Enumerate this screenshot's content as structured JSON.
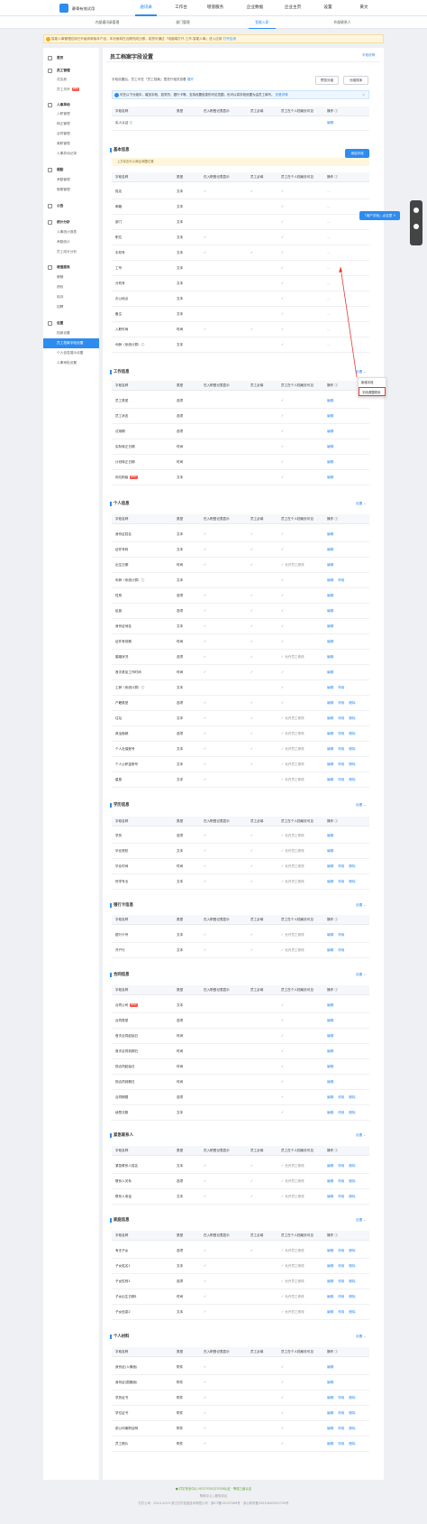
{
  "app_name": "静哥有效试用",
  "nav": [
    "通讯录",
    "工作台",
    "增值服务",
    "企业数据",
    "企业主页",
    "设置"
  ],
  "nav_user": "黄文",
  "subnav": [
    "内部通讯录管理",
    "部门管理",
    "智能入职",
    "外部联系人"
  ],
  "notice": {
    "text": "智能人事管理应用已升级到新版本产品，本页面将在近期完成迁移。若您可通过「电脑端打开-工作-智能人事」进入应用",
    "link": "打开应用"
  },
  "sidebar": {
    "items": [
      {
        "label": "首页",
        "type": "head"
      },
      {
        "label": "员工管理",
        "type": "head"
      },
      {
        "label": "花名册",
        "type": "sub"
      },
      {
        "label": "员工关怀",
        "type": "sub",
        "tag": "NEW"
      },
      {
        "label": "人事异动",
        "type": "head"
      },
      {
        "label": "入职管理",
        "type": "sub"
      },
      {
        "label": "转正管理",
        "type": "sub"
      },
      {
        "label": "合同管理",
        "type": "sub"
      },
      {
        "label": "离职管理",
        "type": "sub"
      },
      {
        "label": "人事异动记录",
        "type": "sub"
      },
      {
        "label": "假勤",
        "type": "head"
      },
      {
        "label": "考勤管理",
        "type": "sub"
      },
      {
        "label": "假期管理",
        "type": "sub"
      },
      {
        "label": "公告",
        "type": "head"
      },
      {
        "label": "统计分析",
        "type": "head"
      },
      {
        "label": "人事统计报表",
        "type": "sub"
      },
      {
        "label": "考勤统计",
        "type": "sub"
      },
      {
        "label": "员工成长分析",
        "type": "sub"
      },
      {
        "label": "增值服务",
        "type": "head"
      },
      {
        "label": "薪酬",
        "type": "sub"
      },
      {
        "label": "绩效",
        "type": "sub"
      },
      {
        "label": "培训",
        "type": "sub"
      },
      {
        "label": "招聘",
        "type": "sub"
      },
      {
        "label": "设置",
        "type": "head"
      },
      {
        "label": "档案设置",
        "type": "sub"
      },
      {
        "label": "员工档案字段设置",
        "type": "sub",
        "active": true
      },
      {
        "label": "个人信息展示设置",
        "type": "sub"
      },
      {
        "label": "人事审批设置",
        "type": "sub"
      }
    ]
  },
  "page": {
    "title": "员工档案字段设置",
    "help": "字段说明",
    "desc": "字段设置后，员工可在「员工档案」里进行相关查看",
    "desc_link": "展开",
    "btn_preview": "预览分组",
    "btn_sort": "分组排序",
    "info": "可在以下分组中，增加字段，如学历、银行卡等。支持设置信息的可见范围，也可以将字段设置为由员工填写。",
    "info_link": "查看详情",
    "add_field": "添加字段",
    "hint": "上方标志可以添加/调整位置",
    "setting": "设置 ⌄"
  },
  "headers": [
    "字段名称",
    "类型",
    "在入职登记表显示",
    "员工必填",
    "员工在个人档案页可见",
    "操作 ⓘ"
  ],
  "tip": "「用户字段」点这里 ✎",
  "dropdown": [
    "新增字段",
    "字段调整顺序"
  ],
  "sections": [
    {
      "id": "top",
      "title": "",
      "rows": [
        {
          "name": "实人认证 ⓘ",
          "type": "",
          "c1": "",
          "c2": "",
          "c3": "",
          "ops": [
            "编辑"
          ]
        }
      ]
    },
    {
      "id": "basic",
      "title": "基本信息",
      "rows": [
        {
          "name": "姓名",
          "type": "文本",
          "c1": "✓",
          "c2": "✓",
          "c3": "✓",
          "ops": [
            "—"
          ]
        },
        {
          "name": "邮箱",
          "type": "文本",
          "c1": "",
          "c2": "",
          "c3": "✓",
          "ops": [
            "—"
          ]
        },
        {
          "name": "部门",
          "type": "文本",
          "c1": "",
          "c2": "",
          "c3": "✓",
          "ops": [
            "—"
          ]
        },
        {
          "name": "职位",
          "type": "文本",
          "c1": "✓",
          "c2": "",
          "c3": "✓",
          "ops": [
            "—"
          ]
        },
        {
          "name": "手机号",
          "type": "文本",
          "c1": "✓",
          "c2": "✓",
          "c3": "✓",
          "ops": [
            "—"
          ]
        },
        {
          "name": "工号",
          "type": "文本",
          "c1": "",
          "c2": "",
          "c3": "✓",
          "ops": [
            "—"
          ]
        },
        {
          "name": "分机号",
          "type": "文本",
          "c1": "",
          "c2": "",
          "c3": "✓",
          "ops": [
            "—"
          ]
        },
        {
          "name": "办公地点",
          "type": "文本",
          "c1": "",
          "c2": "",
          "c3": "✓",
          "ops": [
            "—"
          ]
        },
        {
          "name": "备注",
          "type": "文本",
          "c1": "",
          "c2": "",
          "c3": "✓",
          "ops": [
            "—"
          ]
        },
        {
          "name": "入职时间",
          "type": "时间",
          "c1": "✓",
          "c2": "✓",
          "c3": "✓",
          "ops": [
            "—"
          ]
        },
        {
          "name": "司龄（系统计算）ⓘ",
          "type": "文本",
          "c1": "",
          "c2": "",
          "c3": "✓",
          "ops": [
            "—"
          ]
        }
      ]
    },
    {
      "id": "work",
      "title": "工作信息",
      "rows": [
        {
          "name": "员工类型",
          "type": "选项",
          "c1": "",
          "c2": "",
          "c3": "✓",
          "ops": [
            "编辑"
          ]
        },
        {
          "name": "员工状态",
          "type": "选项",
          "c1": "",
          "c2": "",
          "c3": "✓",
          "ops": [
            "编辑"
          ]
        },
        {
          "name": "试用期",
          "type": "选项",
          "c1": "",
          "c2": "",
          "c3": "✓",
          "ops": [
            "编辑"
          ]
        },
        {
          "name": "实际转正日期",
          "type": "时间",
          "c1": "",
          "c2": "",
          "c3": "✓",
          "ops": [
            "编辑"
          ]
        },
        {
          "name": "计划转正日期",
          "type": "时间",
          "c1": "",
          "c2": "",
          "c3": "✓",
          "ops": [
            "编辑"
          ]
        },
        {
          "name": "岗位职级",
          "tag": "NEW",
          "type": "文本",
          "c1": "",
          "c2": "",
          "c3": "✓",
          "ops": [
            "编辑"
          ]
        }
      ]
    },
    {
      "id": "personal",
      "title": "个人信息",
      "rows": [
        {
          "name": "身份证姓名",
          "type": "文本",
          "c1": "✓",
          "c2": "✓",
          "c3": "✓",
          "ops": [
            "编辑"
          ]
        },
        {
          "name": "证件号码",
          "type": "文本",
          "c1": "✓",
          "c2": "✓",
          "c3": "✓",
          "ops": [
            "编辑"
          ]
        },
        {
          "name": "出生日期",
          "type": "时间",
          "c1": "✓",
          "c2": "✓",
          "c3": "✓ 允许员工修改",
          "ops": [
            "编辑"
          ]
        },
        {
          "name": "年龄（系统计算）ⓘ",
          "type": "文本",
          "c1": "",
          "c2": "",
          "c3": "✓",
          "ops": [
            "编辑",
            "停用"
          ]
        },
        {
          "name": "性别",
          "type": "选项",
          "c1": "✓",
          "c2": "✓",
          "c3": "✓",
          "ops": [
            "编辑"
          ]
        },
        {
          "name": "民族",
          "type": "选项",
          "c1": "✓",
          "c2": "✓",
          "c3": "✓",
          "ops": [
            "编辑"
          ]
        },
        {
          "name": "身份证地址",
          "type": "文本",
          "c1": "✓",
          "c2": "✓",
          "c3": "✓",
          "ops": [
            "编辑"
          ]
        },
        {
          "name": "证件有效期",
          "type": "时间",
          "c1": "✓",
          "c2": "✓",
          "c3": "✓",
          "ops": [
            "编辑"
          ]
        },
        {
          "name": "婚姻状况",
          "type": "选项",
          "c1": "✓",
          "c2": "✓",
          "c3": "✓ 允许员工修改",
          "ops": [
            "编辑"
          ]
        },
        {
          "name": "首次参加工作时间",
          "type": "时间",
          "c1": "✓",
          "c2": "✓",
          "c3": "✓",
          "ops": [
            "编辑"
          ]
        },
        {
          "name": "工龄（系统计算）ⓘ",
          "type": "文本",
          "c1": "",
          "c2": "",
          "c3": "✓",
          "ops": [
            "编辑",
            "停用"
          ]
        },
        {
          "name": "户籍类型",
          "type": "选项",
          "c1": "✓",
          "c2": "✓",
          "c3": "✓",
          "ops": [
            "编辑",
            "停用",
            "删除"
          ]
        },
        {
          "name": "住址",
          "type": "文本",
          "c1": "✓",
          "c2": "✓",
          "c3": "✓ 允许员工修改",
          "ops": [
            "编辑",
            "停用",
            "删除"
          ]
        },
        {
          "name": "政治面貌",
          "type": "选项",
          "c1": "✓",
          "c2": "✓",
          "c3": "✓ 允许员工修改",
          "ops": [
            "编辑",
            "停用",
            "删除"
          ]
        },
        {
          "name": "个人社保账号",
          "type": "文本",
          "c1": "✓",
          "c2": "✓",
          "c3": "✓ 允许员工修改",
          "ops": [
            "编辑",
            "停用",
            "删除"
          ]
        },
        {
          "name": "个人公积金账号",
          "type": "文本",
          "c1": "✓",
          "c2": "✓",
          "c3": "✓ 允许员工修改",
          "ops": [
            "编辑",
            "停用",
            "删除"
          ]
        },
        {
          "name": "星座",
          "type": "文本",
          "c1": "✓",
          "c2": "",
          "c3": "✓ 允许员工修改",
          "ops": [
            "编辑",
            "停用",
            "删除"
          ]
        }
      ]
    },
    {
      "id": "edu",
      "title": "学历信息",
      "rows": [
        {
          "name": "学历",
          "type": "选项",
          "c1": "✓",
          "c2": "✓",
          "c3": "✓ 允许员工修改",
          "ops": [
            "编辑"
          ]
        },
        {
          "name": "毕业院校",
          "type": "文本",
          "c1": "✓",
          "c2": "✓",
          "c3": "✓ 允许员工修改",
          "ops": [
            "编辑"
          ]
        },
        {
          "name": "毕业时间",
          "type": "时间",
          "c1": "✓",
          "c2": "✓",
          "c3": "✓ 允许员工修改",
          "ops": [
            "编辑",
            "停用",
            "删除"
          ]
        },
        {
          "name": "所学专业",
          "type": "文本",
          "c1": "✓",
          "c2": "✓",
          "c3": "✓ 允许员工修改",
          "ops": [
            "编辑",
            "停用",
            "删除"
          ]
        }
      ]
    },
    {
      "id": "bank",
      "title": "银行卡信息",
      "rows": [
        {
          "name": "银行卡号",
          "type": "文本",
          "c1": "✓",
          "c2": "✓",
          "c3": "✓ 允许员工修改",
          "ops": [
            "编辑",
            "停用"
          ]
        },
        {
          "name": "开户行",
          "type": "文本",
          "c1": "✓",
          "c2": "✓",
          "c3": "✓ 允许员工修改",
          "ops": [
            "编辑",
            "停用"
          ]
        }
      ]
    },
    {
      "id": "contract",
      "title": "合同信息",
      "rows": [
        {
          "name": "合同公司",
          "tag": "NEW",
          "type": "文本",
          "c1": "",
          "c2": "",
          "c3": "✓",
          "ops": [
            "编辑"
          ]
        },
        {
          "name": "合同类型",
          "type": "选项",
          "c1": "",
          "c2": "",
          "c3": "✓",
          "ops": [
            "编辑"
          ]
        },
        {
          "name": "首次合同起始日",
          "type": "时间",
          "c1": "",
          "c2": "",
          "c3": "✓",
          "ops": [
            "编辑"
          ]
        },
        {
          "name": "首次合同到期日",
          "type": "时间",
          "c1": "",
          "c2": "",
          "c3": "✓",
          "ops": [
            "编辑"
          ]
        },
        {
          "name": "现合同起始日",
          "type": "时间",
          "c1": "",
          "c2": "",
          "c3": "✓",
          "ops": [
            "编辑"
          ]
        },
        {
          "name": "现合同到期日",
          "type": "时间",
          "c1": "",
          "c2": "",
          "c3": "✓",
          "ops": [
            "编辑"
          ]
        },
        {
          "name": "合同期限",
          "type": "选项",
          "c1": "",
          "c2": "",
          "c3": "✓",
          "ops": [
            "编辑",
            "停用",
            "删除"
          ]
        },
        {
          "name": "续签次数",
          "type": "文本",
          "c1": "",
          "c2": "",
          "c3": "✓",
          "ops": [
            "编辑",
            "停用",
            "删除"
          ]
        }
      ]
    },
    {
      "id": "emergency",
      "title": "紧急联系人",
      "rows": [
        {
          "name": "紧急联系人姓名",
          "type": "文本",
          "c1": "✓",
          "c2": "✓",
          "c3": "✓ 允许员工修改",
          "ops": [
            "编辑",
            "停用",
            "删除"
          ]
        },
        {
          "name": "联系人关系",
          "type": "选项",
          "c1": "✓",
          "c2": "✓",
          "c3": "✓ 允许员工修改",
          "ops": [
            "编辑",
            "停用",
            "删除"
          ]
        },
        {
          "name": "联系人电话",
          "type": "文本",
          "c1": "✓",
          "c2": "✓",
          "c3": "✓ 允许员工修改",
          "ops": [
            "编辑",
            "停用",
            "删除"
          ]
        }
      ]
    },
    {
      "id": "family",
      "title": "家庭信息",
      "rows": [
        {
          "name": "有无子女",
          "type": "选项",
          "c1": "✓",
          "c2": "✓",
          "c3": "✓ 允许员工修改",
          "ops": [
            "编辑",
            "停用",
            "删除"
          ]
        },
        {
          "name": "子女姓名1",
          "type": "文本",
          "c1": "✓",
          "c2": "",
          "c3": "✓ 允许员工修改",
          "ops": [
            "编辑",
            "停用",
            "删除"
          ]
        },
        {
          "name": "子女性别1",
          "type": "选项",
          "c1": "✓",
          "c2": "",
          "c3": "✓ 允许员工修改",
          "ops": [
            "编辑",
            "停用",
            "删除"
          ]
        },
        {
          "name": "子女出生日期1",
          "type": "时间",
          "c1": "✓",
          "c2": "",
          "c3": "✓ 允许员工修改",
          "ops": [
            "编辑",
            "停用",
            "删除"
          ]
        },
        {
          "name": "子女信息2",
          "type": "文本",
          "c1": "✓",
          "c2": "",
          "c3": "✓ 允许员工修改",
          "ops": [
            "编辑",
            "停用",
            "删除"
          ]
        }
      ]
    },
    {
      "id": "material",
      "title": "个人材料",
      "rows": [
        {
          "name": "身份证(人像面)",
          "type": "附件",
          "c1": "✓",
          "c2": "",
          "c3": "✓",
          "ops": [
            "编辑"
          ]
        },
        {
          "name": "身份证(国徽面)",
          "type": "附件",
          "c1": "✓",
          "c2": "",
          "c3": "✓",
          "ops": [
            "编辑"
          ]
        },
        {
          "name": "学历证书",
          "type": "附件",
          "c1": "✓",
          "c2": "",
          "c3": "✓",
          "ops": [
            "编辑",
            "停用",
            "删除"
          ]
        },
        {
          "name": "学位证书",
          "type": "附件",
          "c1": "✓",
          "c2": "",
          "c3": "✓",
          "ops": [
            "编辑",
            "停用",
            "删除"
          ]
        },
        {
          "name": "前公司离职证明",
          "type": "附件",
          "c1": "✓",
          "c2": "",
          "c3": "✓",
          "ops": [
            "编辑",
            "停用",
            "删除"
          ]
        },
        {
          "name": "员工照片",
          "type": "附件",
          "c1": "✓",
          "c2": "",
          "c3": "✓",
          "ops": [
            "编辑",
            "停用",
            "删除"
          ]
        }
      ]
    }
  ],
  "footer": {
    "line1": "● 钉钉安全中心 ISO27001/27018认证 · 等保三级认证",
    "line2": "帮助中心  |  服务协议",
    "line3": "钉钉公司 · 2014-2019 浙江钉钉信息技术有限公司 · 浙ICP备15037066号 · 浙公网安备33010602009750号"
  }
}
